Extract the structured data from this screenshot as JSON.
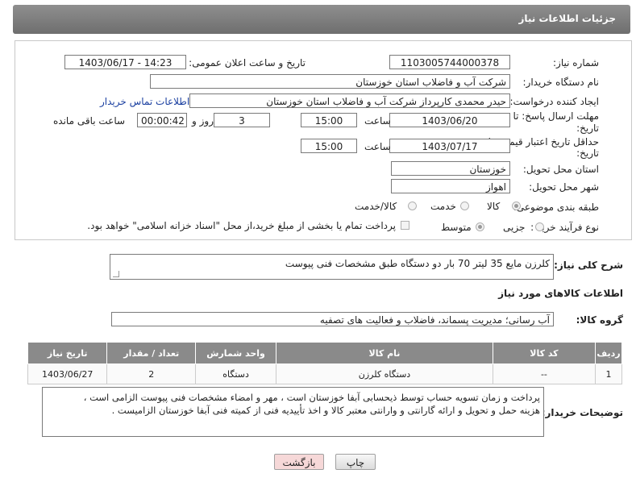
{
  "header": {
    "title": "جزئیات اطلاعات نیاز"
  },
  "form": {
    "need_number_label": "شماره نیاز:",
    "need_number": "1103005744000378",
    "announce_label": "تاریخ و ساعت اعلان عمومی:",
    "announce_value": "1403/06/17 - 14:23",
    "buyer_org_label": "نام دستگاه خریدار:",
    "buyer_org": "شرکت آب و فاضلاب استان خوزستان",
    "creator_label": "ایجاد کننده درخواست:",
    "creator": "حیدر محمدی کارپرداز شرکت آب و فاضلاب استان خوزستان",
    "contact_link": "اطلاعات تماس خریدار",
    "deadline_label_1": "مهلت ارسال پاسخ: تا",
    "deadline_label_2": "تاریخ:",
    "deadline_date": "1403/06/20",
    "time_label": "ساعت",
    "deadline_time": "15:00",
    "days": "3",
    "days_label": "روز و",
    "remaining": "00:00:42",
    "remaining_label": "ساعت باقی مانده",
    "validity_label_1": "حداقل تاریخ اعتبار قیمت: تا",
    "validity_label_2": "تاریخ:",
    "validity_date": "1403/07/17",
    "validity_time": "15:00",
    "province_label": "استان محل تحویل:",
    "province": "خوزستان",
    "city_label": "شهر محل تحویل:",
    "city": "اهواز",
    "category_label": "طبقه بندی موضوعی:",
    "category_options": [
      "کالا",
      "خدمت",
      "کالا/خدمت"
    ],
    "process_label": "نوع فرآیند خرید :",
    "process_options": [
      "جزیی",
      "متوسط"
    ],
    "payment_note": "پرداخت تمام یا بخشی از مبلغ خرید،از محل \"اسناد خزانه اسلامی\" خواهد بود."
  },
  "description": {
    "label": "شرح کلی نیاز:",
    "value": "کلرزن مایع 35 لیتر 70 بار دو دستگاه طبق مشخصات فنی پیوست"
  },
  "items_section": {
    "title": "اطلاعات کالاهای مورد نیاز",
    "group_label": "گروه کالا:",
    "group_value": "آب رسانی؛ مدیریت پسماند، فاضلاب و فعالیت های تصفیه",
    "columns": [
      "ردیف",
      "کد کالا",
      "نام کالا",
      "واحد شمارش",
      "تعداد / مقدار",
      "تاریخ نیاز"
    ],
    "rows": [
      [
        "1",
        "--",
        "دستگاه کلرزن",
        "دستگاه",
        "2",
        "1403/06/27"
      ]
    ]
  },
  "buyer_notes": {
    "label": "توضیحات خریدار:",
    "lines": [
      "پرداخت و زمان تسویه حساب توسط ذیحسابی آبفا خوزستان است ، مهر و امضاء مشخصات فنی پیوست الزامی است ،",
      "هزینه حمل و تحویل و ارائه گارانتی و وارانتی معتبر کالا و اخذ تأییدیه فنی از کمیته فنی آبفا خوزستان الزامیست ."
    ]
  },
  "buttons": {
    "print": "چاپ",
    "back": "بازگشت"
  },
  "colors": {
    "accent_link": "#1a3fa0",
    "header_bg": "#7e7e7e",
    "back_bg": "#f6d8d8"
  }
}
